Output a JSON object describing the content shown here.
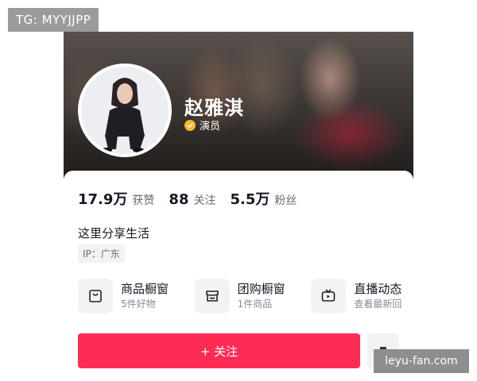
{
  "profile": {
    "name": "赵雅淇",
    "role": "演员",
    "bio": "这里分享生活",
    "ip_label": "IP：广东"
  },
  "stats": [
    {
      "value": "17.9万",
      "label": "获赞"
    },
    {
      "value": "88",
      "label": "关注"
    },
    {
      "value": "5.5万",
      "label": "粉丝"
    }
  ],
  "features": [
    {
      "title": "商品橱窗",
      "subtitle": "5件好物",
      "icon": "bag-icon"
    },
    {
      "title": "团购橱窗",
      "subtitle": "1件商品",
      "icon": "store-icon"
    },
    {
      "title": "直播动态",
      "subtitle": "查看最新回",
      "icon": "tv-icon"
    }
  ],
  "actions": {
    "follow_label": "+ 关注"
  },
  "watermarks": {
    "top_left": "TG: MYYJJPP",
    "bottom_right": "leyu-fan.com"
  },
  "colors": {
    "accent": "#fe2c55",
    "verify_badge": "#f5b82e"
  }
}
